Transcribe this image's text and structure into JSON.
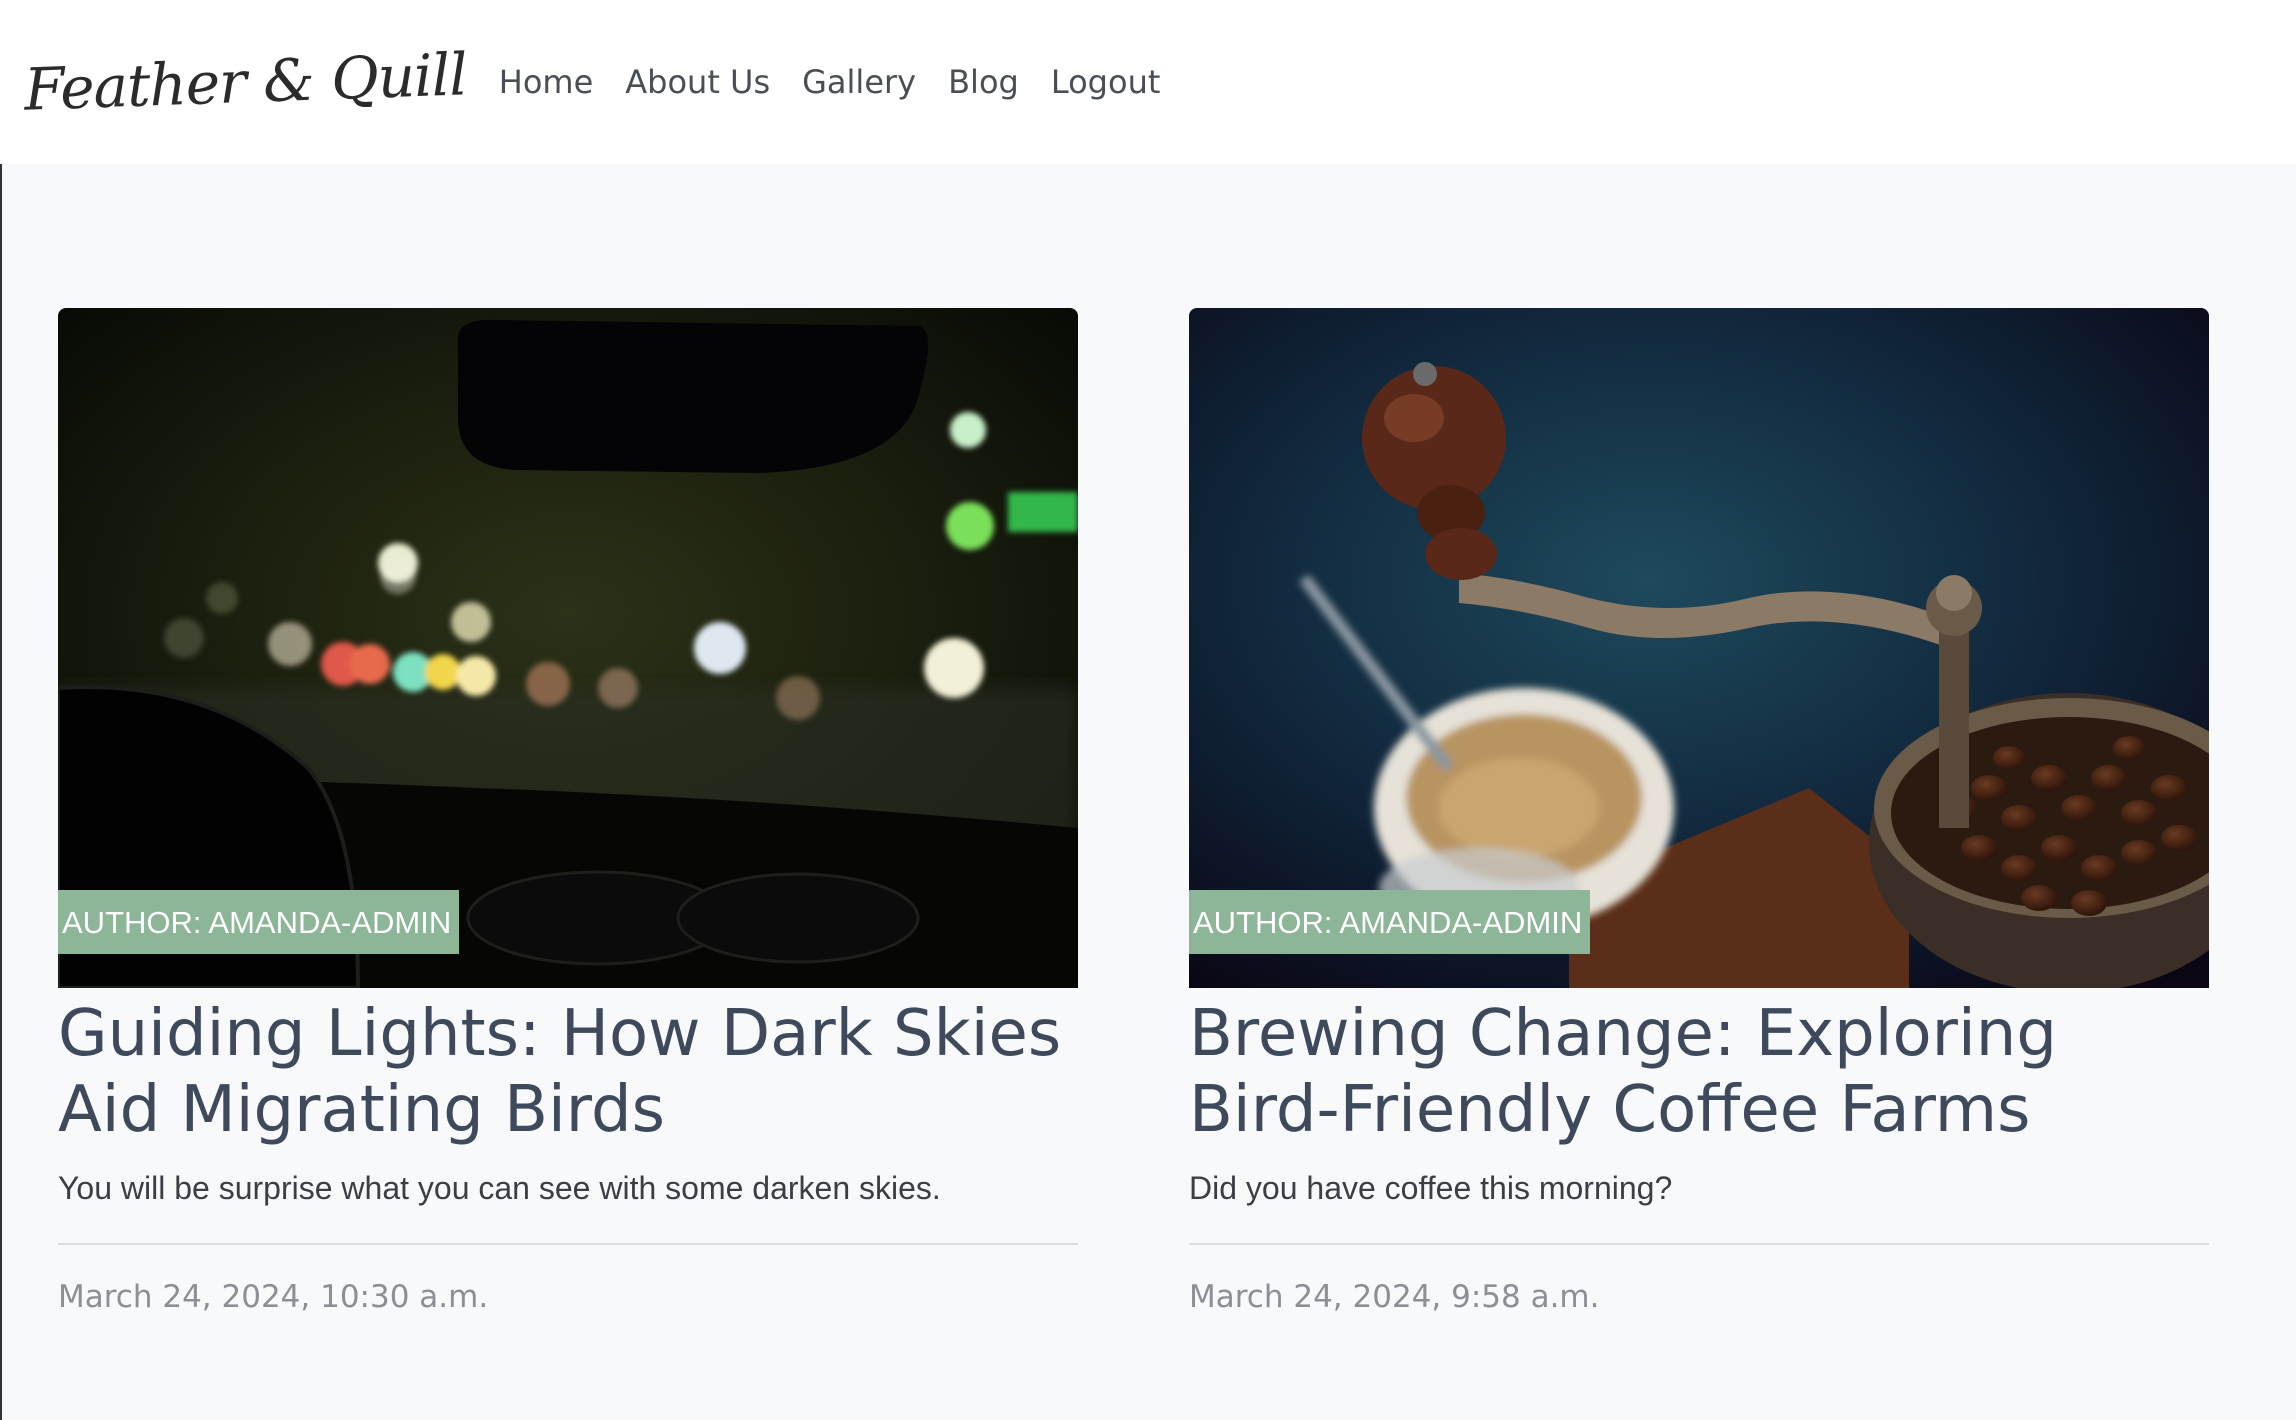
{
  "nav": {
    "brand": "Feather & Quill",
    "links": [
      "Home",
      "About Us",
      "Gallery",
      "Blog",
      "Logout"
    ]
  },
  "posts": [
    {
      "author": "AUTHOR: AMANDA-ADMIN",
      "title": "Guiding Lights: How Dark Skies Aid Migrating Birds",
      "excerpt": "You will be surprise what you can see with some darken skies.",
      "date": "March 24, 2024, 10:30 a.m."
    },
    {
      "author": "AUTHOR: AMANDA-ADMIN",
      "title": "Brewing Change: Exploring Bird-Friendly Coffee Farms",
      "excerpt": "Did you have coffee this morning?",
      "date": "March 24, 2024, 9:58 a.m."
    }
  ],
  "colors": {
    "badge": "#8db598",
    "title": "#3e4a5c",
    "date": "#8b9096"
  }
}
